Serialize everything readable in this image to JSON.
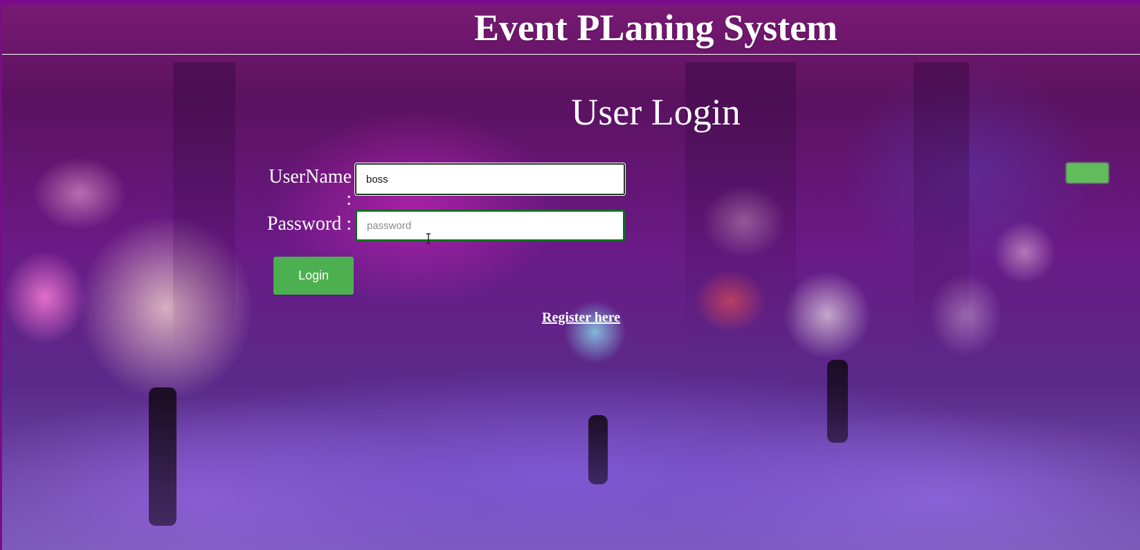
{
  "header": {
    "site_title": "Event PLaning System"
  },
  "login_form": {
    "heading": "User Login",
    "username_label": "UserName :",
    "username_value": "boss",
    "password_label": "Password :",
    "password_value": "",
    "password_placeholder": "password",
    "login_button_label": "Login",
    "register_link_label": "Register here"
  },
  "colors": {
    "frame": "#7a0c8c",
    "login_button": "#4caf50",
    "password_border": "#0b6f1f",
    "text": "#ffffff"
  },
  "icons": {
    "cursor": "text-cursor-icon"
  }
}
